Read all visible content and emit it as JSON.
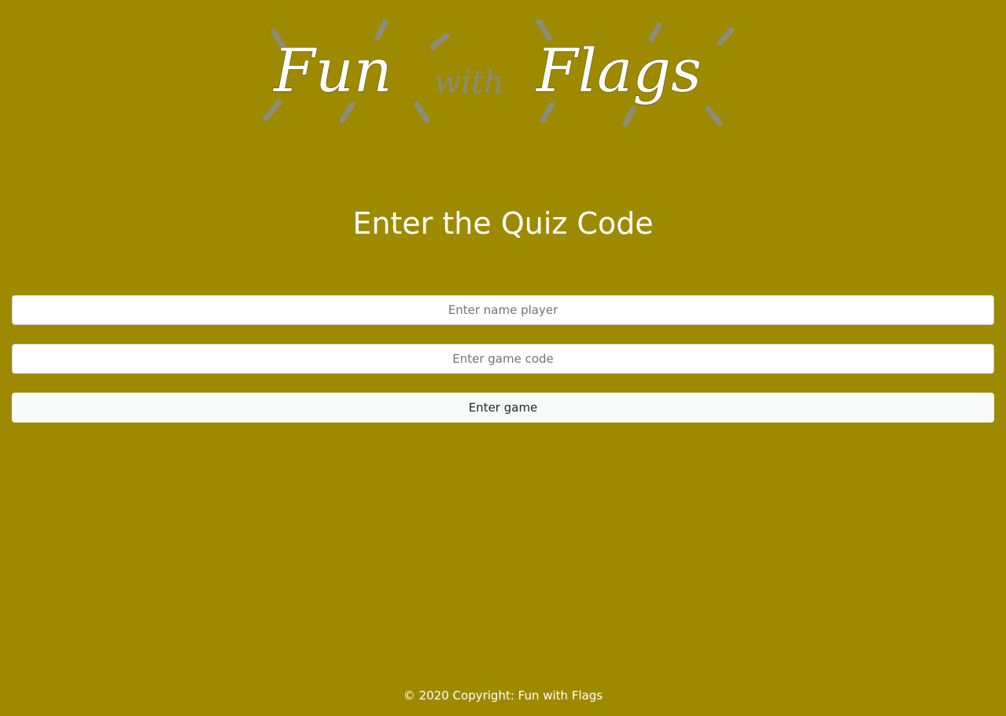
{
  "logo": {
    "word_fun": "Fun",
    "word_with": "with",
    "word_flags": "Flags"
  },
  "heading": "Enter the Quiz Code",
  "form": {
    "name_placeholder": "Enter name player",
    "name_value": "",
    "code_placeholder": "Enter game code",
    "code_value": "",
    "submit_label": "Enter game"
  },
  "footer": {
    "copyright": "© 2020 Copyright: Fun with Flags"
  },
  "colors": {
    "background": "#9e8a00",
    "logo_rays": "#8d8d7d",
    "text": "#ffffff"
  }
}
